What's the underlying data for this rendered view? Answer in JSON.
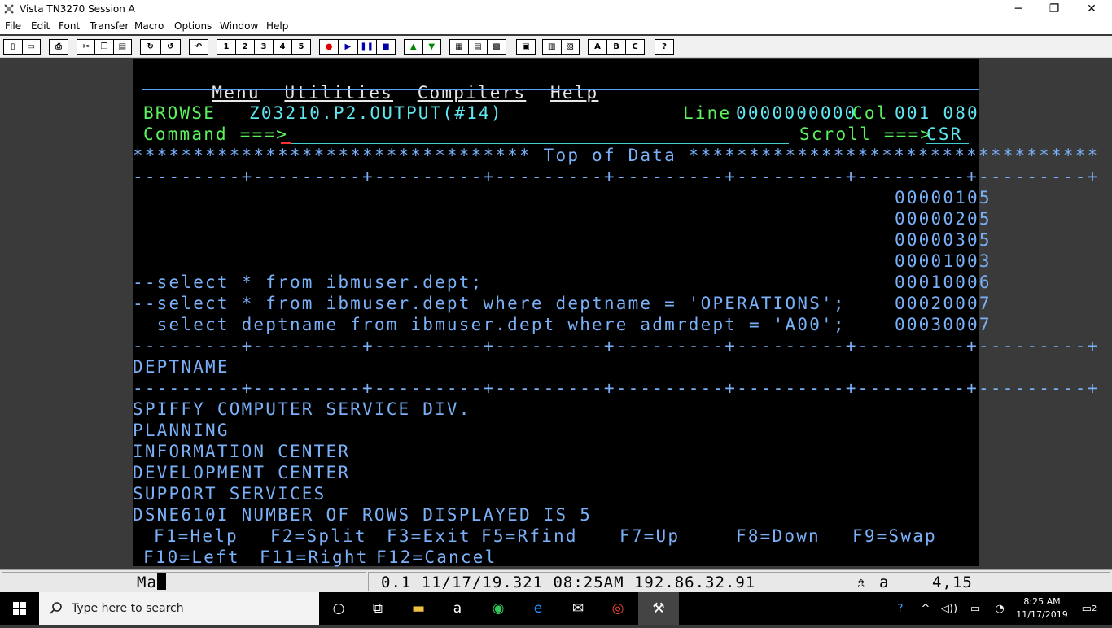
{
  "window": {
    "title": "Vista TN3270 Session A",
    "minimize": "─",
    "restore": "❐",
    "close": "✕"
  },
  "menubar": {
    "items": [
      "File",
      "Edit",
      "Font",
      "Transfer",
      "Macro",
      "Options",
      "Window",
      "Help"
    ]
  },
  "toolbar": {
    "macro_buttons": [
      "1",
      "2",
      "3",
      "4",
      "5"
    ],
    "abc_buttons": [
      "A",
      "B",
      "C"
    ],
    "help": "?"
  },
  "ispf": {
    "menu_items": [
      "Menu",
      "Utilities",
      "Compilers",
      "Help"
    ],
    "mode": "BROWSE",
    "dataset": "Z03210.P2.OUTPUT(#14)",
    "line_label": "Line",
    "line_value": "0000000000",
    "col_label": "Col",
    "col_value": "001 080",
    "command_label": "Command ===>",
    "scroll_label": "Scroll ===>",
    "scroll_value": "CSR",
    "top_of_data": "********************************* Top of Data **********************************",
    "ruler": "---------+---------+---------+---------+---------+---------+---------+---------+",
    "seq_only_lines": [
      "00000105",
      "00000205",
      "00000305",
      "00001003"
    ],
    "sql_lines": [
      {
        "text": "--select * from ibmuser.dept;",
        "seq": "00010006"
      },
      {
        "text": "--select * from ibmuser.dept where deptname = 'OPERATIONS';",
        "seq": "00020007"
      },
      {
        "text": "  select deptname from ibmuser.dept where admrdept = 'A00';",
        "seq": "00030007"
      }
    ],
    "column_header": "DEPTNAME",
    "results": [
      "SPIFFY COMPUTER SERVICE DIV.",
      "PLANNING",
      "INFORMATION CENTER",
      "DEVELOPMENT CENTER",
      "SUPPORT SERVICES"
    ],
    "message": "DSNE610I NUMBER OF ROWS DISPLAYED IS 5",
    "fkeys_row1": [
      "F1=Help",
      "F2=Split",
      "F3=Exit",
      "F5=Rfind",
      "F7=Up",
      "F8=Down",
      "F9=Swap"
    ],
    "fkeys_row2": [
      "F10=Left",
      "F11=Right",
      "F12=Cancel"
    ]
  },
  "status": {
    "indicator": "Ma",
    "session_info": "0.1 11/17/19.321 08:25AM 192.86.32.91",
    "shift": "⇯",
    "mode_char": "a",
    "cursor_pos": "4,15"
  },
  "taskbar": {
    "search_placeholder": "Type here to search",
    "time": "8:25 AM",
    "date": "11/17/2019",
    "notification_count": "2"
  }
}
